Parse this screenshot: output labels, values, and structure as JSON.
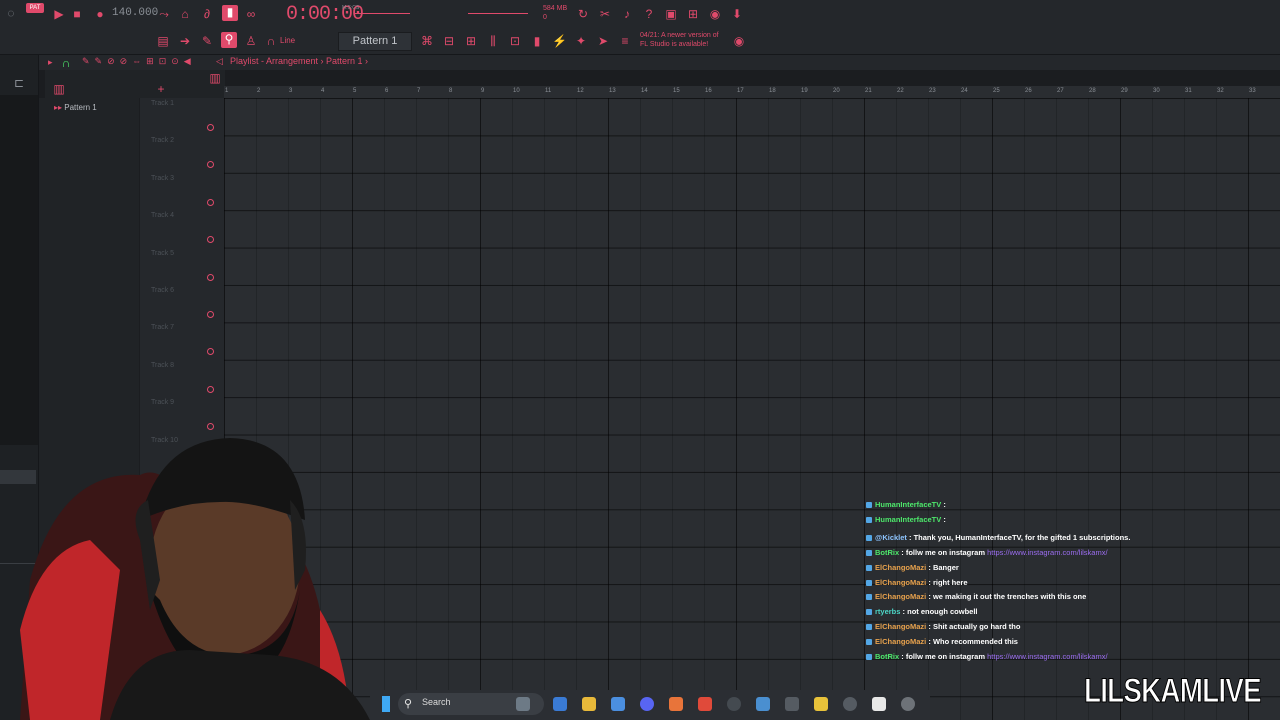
{
  "toolbar": {
    "tempo": "140.000",
    "clock": "0:00:00",
    "clock_sub": "M:S:CS",
    "memory_top": "584 MB",
    "memory_bottom": "0",
    "pattern_selector": "Pattern 1",
    "snap_mode": "Line",
    "update_notice_line1": "04/21: A newer version of",
    "update_notice_line2": "FL Studio is available!"
  },
  "playlist": {
    "breadcrumb": "Playlist - Arrangement › Pattern 1 ›",
    "pattern_item": "Pattern 1",
    "tracks": [
      "Track 1",
      "Track 2",
      "Track 3",
      "Track 4",
      "Track 5",
      "Track 6",
      "Track 7",
      "Track 8",
      "Track 9",
      "Track 10"
    ],
    "ruler": [
      "1",
      "2",
      "3",
      "4",
      "5",
      "6",
      "7",
      "8",
      "9",
      "10",
      "11",
      "12",
      "13",
      "14",
      "15",
      "16",
      "17",
      "18",
      "19",
      "20",
      "21",
      "22",
      "23",
      "24",
      "25",
      "26",
      "27",
      "28",
      "29",
      "30",
      "31",
      "32",
      "33"
    ]
  },
  "chat": [
    {
      "user": "HumanInterfaceTV",
      "user_color": "#4de86b",
      "msg": "",
      "link": ""
    },
    {
      "user": "HumanInterfaceTV",
      "user_color": "#4de86b",
      "msg": "",
      "link": ""
    },
    {
      "user": "@Kicklet",
      "user_color": "#8ec5ff",
      "msg": "Thank you, HumanInterfaceTV, for the gifted 1 subscriptions.",
      "link": ""
    },
    {
      "user": "BotRix",
      "user_color": "#4de86b",
      "msg": "follw me on instagram",
      "link": "https://www.instagram.com/lilskamx/"
    },
    {
      "user": "ElChangoMazi",
      "user_color": "#e8a24d",
      "msg": "Banger",
      "link": ""
    },
    {
      "user": "ElChangoMazi",
      "user_color": "#e8a24d",
      "msg": "right here",
      "link": ""
    },
    {
      "user": "ElChangoMazi",
      "user_color": "#e8a24d",
      "msg": "we making it out the trenches with this one",
      "link": ""
    },
    {
      "user": "rtyerbs",
      "user_color": "#4dd8c8",
      "msg": "not enough cowbell",
      "link": ""
    },
    {
      "user": "ElChangoMazi",
      "user_color": "#e8a24d",
      "msg": "Shit actually go hard tho",
      "link": ""
    },
    {
      "user": "ElChangoMazi",
      "user_color": "#e8a24d",
      "msg": "Who recommended this",
      "link": ""
    },
    {
      "user": "BotRix",
      "user_color": "#4de86b",
      "msg": "follw me on instagram",
      "link": "https://www.instagram.com/lilskamx/"
    }
  ],
  "taskbar": {
    "search_label": "Search"
  },
  "overlay": {
    "brand": "LILSKAMLIVE"
  },
  "colors": {
    "accent": "#e04a6b",
    "background": "#1b1d20"
  }
}
